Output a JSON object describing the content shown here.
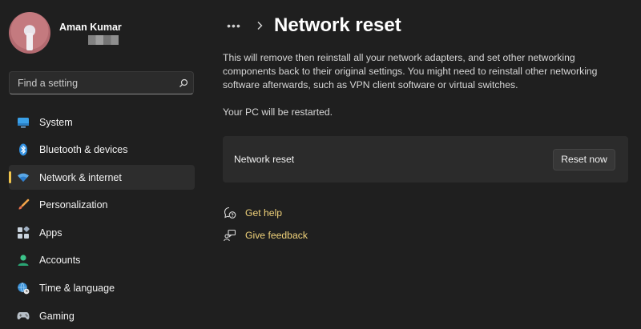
{
  "profile": {
    "name": "Aman Kumar"
  },
  "search": {
    "placeholder": "Find a setting"
  },
  "sidebar": {
    "items": [
      {
        "label": "System",
        "icon": "monitor-icon",
        "active": false
      },
      {
        "label": "Bluetooth & devices",
        "icon": "bluetooth-icon",
        "active": false
      },
      {
        "label": "Network & internet",
        "icon": "wifi-icon",
        "active": true
      },
      {
        "label": "Personalization",
        "icon": "brush-icon",
        "active": false
      },
      {
        "label": "Apps",
        "icon": "apps-icon",
        "active": false
      },
      {
        "label": "Accounts",
        "icon": "person-icon",
        "active": false
      },
      {
        "label": "Time & language",
        "icon": "globe-clock-icon",
        "active": false
      },
      {
        "label": "Gaming",
        "icon": "gamepad-icon",
        "active": false
      }
    ]
  },
  "header": {
    "more": "•••",
    "title": "Network reset"
  },
  "main": {
    "description": "This will remove then reinstall all your network adapters, and set other networking components back to their original settings. You might need to reinstall other networking software afterwards, such as VPN client software or virtual switches.",
    "restart_note": "Your PC will be restarted.",
    "card_label": "Network reset",
    "reset_button": "Reset now",
    "help_link": "Get help",
    "feedback_link": "Give feedback"
  },
  "colors": {
    "accent": "#f0c44c",
    "link": "#f0d27a",
    "background": "#1f1f1f",
    "card": "#2b2b2b"
  }
}
